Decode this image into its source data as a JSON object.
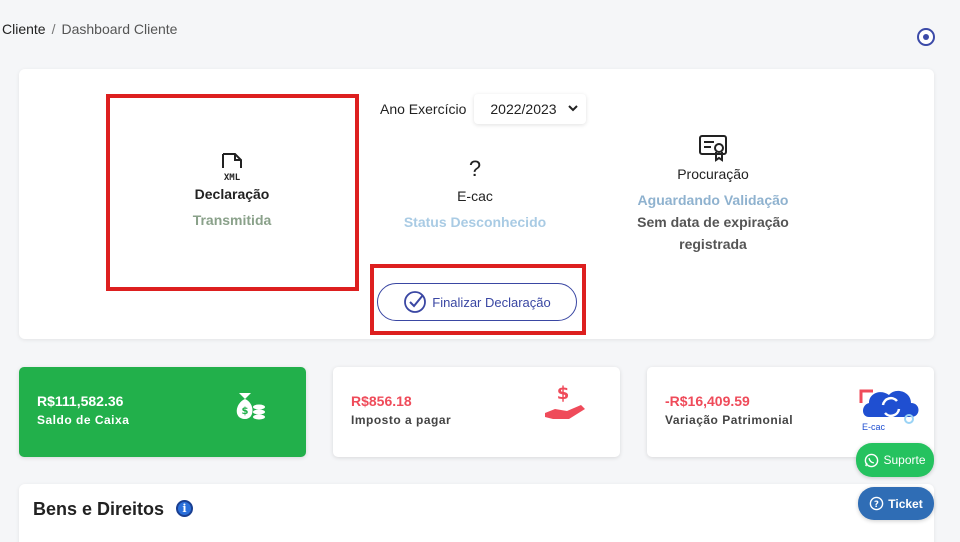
{
  "breadcrumb": {
    "root": "Cliente",
    "separator": "/",
    "current": "Dashboard Cliente"
  },
  "year": {
    "label": "Ano Exercício",
    "selected": "2022/2023"
  },
  "declaracao": {
    "icon": "xml-file-icon",
    "title": "Declaração",
    "status": "Transmitida",
    "status_color": "#8aa18a"
  },
  "ecac": {
    "icon": "question-icon",
    "title": "E-cac",
    "status": "Status Desconhecido",
    "status_color": "#a9cbe4"
  },
  "procuracao": {
    "icon": "certificate-icon",
    "title": "Procuração",
    "status": "Aguardando Validação",
    "status_color": "#8fb2cf",
    "note_line1": "Sem data de expiração",
    "note_line2": "registrada"
  },
  "finalize_button": {
    "label": "Finalizar Declaração"
  },
  "cards": [
    {
      "value": "R$111,582.36",
      "label": "Saldo de Caixa",
      "icon": "money-bag-icon"
    },
    {
      "value": "R$856.18",
      "label": "Imposto a pagar",
      "icon": "hand-dollar-icon"
    },
    {
      "value": "-R$16,409.59",
      "label": "Variação Patrimonial",
      "icon": "ecac-cloud-icon",
      "icon_text": "E-cac"
    }
  ],
  "bens": {
    "title": "Bens e Direitos",
    "info_icon": "i"
  },
  "float_buttons": {
    "suporte": "Suporte",
    "ticket": "Ticket"
  },
  "colors": {
    "accent": "#3a47a3",
    "green": "#22b04b",
    "red_value": "#ef4b5a",
    "highlight": "#dd1f1f"
  }
}
